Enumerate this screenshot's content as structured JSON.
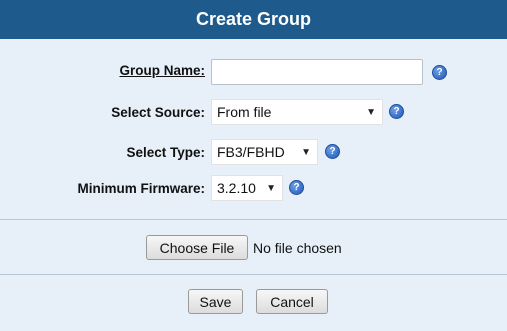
{
  "dialog": {
    "title": "Create Group",
    "fields": {
      "group_name": {
        "label": "Group Name:",
        "value": ""
      },
      "source": {
        "label": "Select Source:",
        "value": "From file"
      },
      "type": {
        "label": "Select Type:",
        "value": "FB3/FBHD"
      },
      "firmware": {
        "label": "Minimum Firmware:",
        "value": "3.2.10"
      }
    },
    "help_glyph": "?",
    "file": {
      "button_label": "Choose File",
      "status": "No file chosen"
    },
    "actions": {
      "save_label": "Save",
      "cancel_label": "Cancel"
    }
  },
  "icons": {
    "help": "help-icon",
    "dropdown": "dropdown-caret-icon"
  },
  "colors": {
    "title_bar": "#1e5a8c",
    "panel": "#e7f0f8",
    "help_icon": "#2456b5"
  }
}
